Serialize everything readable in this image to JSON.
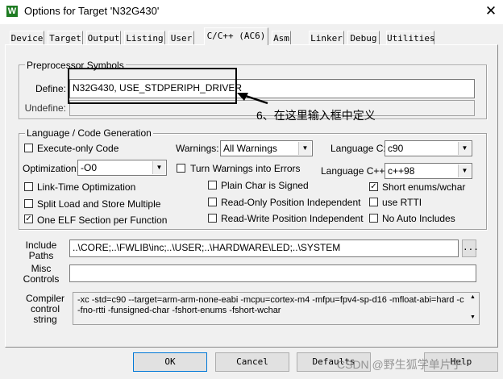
{
  "window": {
    "title": "Options for Target 'N32G430'",
    "icon_letter": "W",
    "close_glyph": "✕"
  },
  "tabs": [
    {
      "label": "Device"
    },
    {
      "label": "Target"
    },
    {
      "label": "Output"
    },
    {
      "label": "Listing"
    },
    {
      "label": "User"
    },
    {
      "label": "C/C++ (AC6)",
      "active": true
    },
    {
      "label": "Asm"
    },
    {
      "label": "Linker"
    },
    {
      "label": "Debug"
    },
    {
      "label": "Utilities"
    }
  ],
  "preprocessor": {
    "group_title": "Preprocessor Symbols",
    "define_label": "Define:",
    "define_value": "N32G430, USE_STDPERIPH_DRIVER",
    "undefine_label": "Undefine:",
    "undefine_value": ""
  },
  "annotation": {
    "text": "6、在这里输入框中定义"
  },
  "language": {
    "group_title": "Language / Code Generation",
    "execute_only": {
      "label": "Execute-only Code",
      "checked": false
    },
    "warnings": {
      "label": "Warnings:",
      "value": "All Warnings"
    },
    "language_c": {
      "label": "Language C:",
      "value": "c90"
    },
    "optimization": {
      "label": "Optimization:",
      "value": "-O0"
    },
    "turn_warnings": {
      "label": "Turn Warnings into Errors",
      "checked": false
    },
    "language_cpp": {
      "label": "Language C++:",
      "value": "c++98"
    },
    "link_time": {
      "label": "Link-Time Optimization",
      "checked": false
    },
    "plain_char": {
      "label": "Plain Char is Signed",
      "checked": false
    },
    "short_enums": {
      "label": "Short enums/wchar",
      "checked": true
    },
    "split_load": {
      "label": "Split Load and Store Multiple",
      "checked": false
    },
    "read_only": {
      "label": "Read-Only Position Independent",
      "checked": false
    },
    "use_rtti": {
      "label": "use RTTI",
      "checked": false
    },
    "one_elf": {
      "label": "One ELF Section per Function",
      "checked": true
    },
    "read_write": {
      "label": "Read-Write Position Independent",
      "checked": false
    },
    "no_auto": {
      "label": "No Auto Includes",
      "checked": false
    }
  },
  "include": {
    "label_line1": "Include",
    "label_line2": "Paths",
    "value": "..\\CORE;..\\FWLIB\\inc;..\\USER;..\\HARDWARE\\LED;..\\SYSTEM",
    "browse_label": "..."
  },
  "misc": {
    "label_line1": "Misc",
    "label_line2": "Controls",
    "value": ""
  },
  "compiler": {
    "label_line1": "Compiler",
    "label_line2": "control",
    "label_line3": "string",
    "line1": "-xc -std=c90 --target=arm-arm-none-eabi -mcpu=cortex-m4 -mfpu=fpv4-sp-d16 -mfloat-abi=hard -c",
    "line2": "-fno-rtti -funsigned-char -fshort-enums -fshort-wchar"
  },
  "buttons": {
    "ok": "OK",
    "cancel": "Cancel",
    "defaults": "Defaults",
    "help": "Help"
  },
  "watermark": "CSDN @野生狐学单片子",
  "check_glyph": "✓",
  "dropdown_glyph": "▼",
  "colors": {
    "accent_green": "#1e7b22"
  }
}
